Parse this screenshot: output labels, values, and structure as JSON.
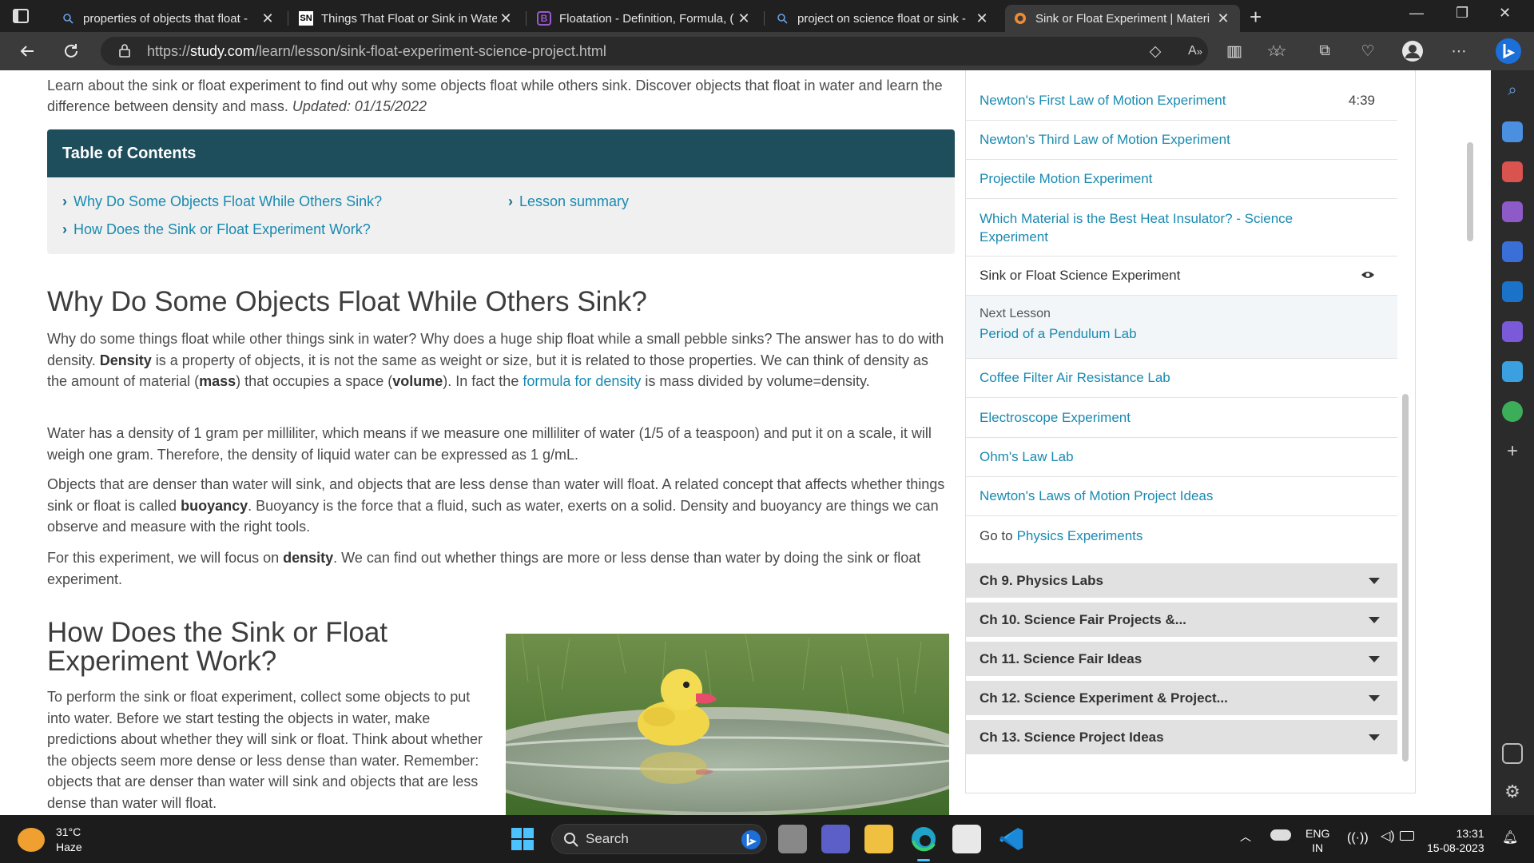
{
  "tabs": [
    {
      "title": "properties of objects that float -",
      "icon": "search-icon",
      "active": false
    },
    {
      "title": "Things That Float or Sink in Wate",
      "icon": "sn-favicon",
      "active": false
    },
    {
      "title": "Floatation - Definition, Formula, (",
      "icon": "byjus-favicon",
      "active": false
    },
    {
      "title": "project on science float or sink -",
      "icon": "search-icon",
      "active": false
    },
    {
      "title": "Sink or Float Experiment | Materi",
      "icon": "study-favicon",
      "active": true
    }
  ],
  "address": {
    "prefix": "https://",
    "domain": "study.com",
    "path": "/learn/lesson/sink-float-experiment-science-project.html"
  },
  "intro": {
    "text": "Learn about the sink or float experiment to find out why some objects float while others sink. Discover objects that float in water and learn the difference between density and mass.",
    "updated": "Updated: 01/15/2022"
  },
  "toc": {
    "heading": "Table of Contents",
    "links": [
      "Why Do Some Objects Float While Others Sink?",
      "How Does the Sink or Float Experiment Work?",
      "Lesson summary"
    ]
  },
  "section1": {
    "heading": "Why Do Some Objects Float While Others Sink?",
    "p1_a": "Why do some things float while other things sink in water? Why does a huge ship float while a small pebble sinks? The answer has to do with density. ",
    "p1_b": "Density",
    "p1_c": " is a property of objects, it is not the same as weight or size, but it is related to those properties. We can think of density as the amount of material (",
    "p1_d": "mass",
    "p1_e": ") that occupies a space (",
    "p1_f": "volume",
    "p1_g": "). In fact the ",
    "p1_link": "formula for density",
    "p1_h": " is mass divided by volume=density.",
    "p2": "Water has a density of 1 gram per milliliter, which means if we measure one milliliter of water (1/5 of a teaspoon) and put it on a scale, it will weigh one gram. Therefore, the density of liquid water can be expressed as 1 g/mL.",
    "p3_a": "Objects that are denser than water will sink, and objects that are less dense than water will float. A related concept that affects whether things sink or float is called ",
    "p3_b": "buoyancy",
    "p3_c": ". Buoyancy is the force that a fluid, such as water, exerts on a solid. Density and buoyancy are things we can observe and measure with the right tools.",
    "p4_a": "For this experiment, we will focus on ",
    "p4_b": "density",
    "p4_c": ". We can find out whether things are more or less dense than water by doing the sink or float experiment."
  },
  "section2": {
    "heading_line1": "How Does the Sink or Float",
    "heading_line2": "Experiment Work?",
    "p1": "To perform the sink or float experiment, collect some objects to put into water. Before we start testing the objects in water, make predictions about whether they will sink or float. Think about whether the objects seem more dense or less dense than water. Remember: objects that are denser than water will sink and objects that are less dense than water will float."
  },
  "sidebar": {
    "items": [
      {
        "label": "Newton's First Law of Motion Experiment",
        "time": "4:39"
      },
      {
        "label": "Newton's Third Law of Motion Experiment"
      },
      {
        "label": "Projectile Motion Experiment"
      },
      {
        "label": "Which Material is the Best Heat Insulator? - Science Experiment"
      },
      {
        "label": "Sink or Float Science Experiment"
      },
      {
        "next_label": "Next Lesson",
        "label": "Period of a Pendulum Lab"
      },
      {
        "label": "Coffee Filter Air Resistance Lab"
      },
      {
        "label": "Electroscope Experiment"
      },
      {
        "label": "Ohm's Law Lab"
      },
      {
        "label": "Newton's Laws of Motion Project Ideas"
      },
      {
        "goto_prefix": "Go to",
        "label": "Physics Experiments"
      }
    ],
    "chapters": [
      "Ch 9. Physics Labs",
      "Ch 10. Science Fair Projects &...",
      "Ch 11. Science Fair Ideas",
      "Ch 12. Science Experiment & Project...",
      "Ch 13. Science Project Ideas"
    ]
  },
  "taskbar": {
    "weather_temp": "31°C",
    "weather_desc": "Haze",
    "search_label": "Search",
    "lang_line1": "ENG",
    "lang_line2": "IN",
    "time": "13:31",
    "date": "15-08-2023"
  },
  "colors": {
    "accent": "#1a8ab0",
    "toc_header": "#1e4d5c",
    "chapter_bg": "#e1e1e1"
  }
}
